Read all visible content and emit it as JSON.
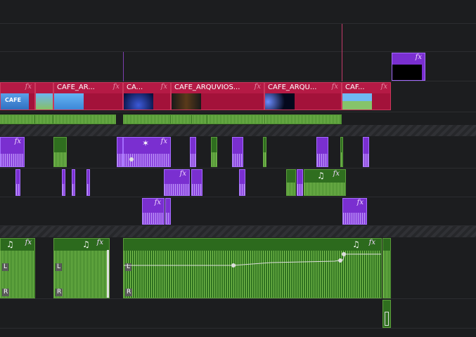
{
  "timeline": {
    "video_clips": [
      {
        "name": "",
        "fx": "fx",
        "thumb": "CAFE"
      },
      {
        "name": "",
        "fx": "",
        "thumb": ""
      },
      {
        "name": "CAFE_AR...",
        "fx": "fx",
        "thumb": ""
      },
      {
        "name": "CA...",
        "fx": "fx",
        "thumb": ""
      },
      {
        "name": "CAFE_ARQUVIOS...",
        "fx": "fx",
        "thumb": ""
      },
      {
        "name": "CAFE_ARQU...",
        "fx": "fx",
        "thumb": ""
      },
      {
        "name": "CAF...",
        "fx": "fx",
        "thumb": ""
      }
    ],
    "title_clip": {
      "fx": "fx"
    },
    "effect_clips": {
      "fx": "fx",
      "star": "✶",
      "note": "♫"
    },
    "audio_clips": [
      {
        "note": "♫",
        "fx": "fx",
        "left_channel": "L",
        "right_channel": "R"
      },
      {
        "note": "♫",
        "fx": "fx",
        "left_channel": "L",
        "right_channel": "R"
      },
      {
        "note": "♫",
        "fx": "fx",
        "left_channel": "L",
        "right_channel": "R"
      }
    ],
    "thumbnail_text": "CAFE",
    "colors": {
      "background": "#1c1d1f",
      "video_clip": "#a3123a",
      "title_clip": "#7a2fd0",
      "audio_clip": "#2c6a1d",
      "waveform": "#7ec451",
      "marker": "#c43a6a"
    }
  }
}
